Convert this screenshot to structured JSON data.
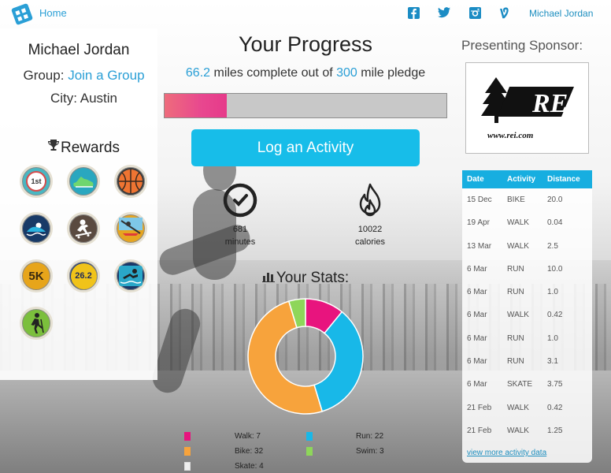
{
  "header": {
    "home_label": "Home",
    "user_name": "Michael Jordan",
    "social_icons": [
      "facebook-icon",
      "twitter-icon",
      "instagram-icon",
      "vine-icon"
    ]
  },
  "profile": {
    "name": "Michael Jordan",
    "group_prefix": "Group:",
    "group_link": "Join a Group",
    "city": "City: Austin",
    "rewards_title": "Rewards",
    "badges": [
      "first-place-badge",
      "running-shoe-badge",
      "basketball-badge",
      "swimming-badge",
      "skateboard-badge",
      "rowing-badge",
      "5k-badge",
      "26-2-marathon-badge",
      "swimmer-badge",
      "hiking-badge"
    ],
    "badge_text": {
      "first": "1st",
      "5k": "5K",
      "marathon": "26.2"
    }
  },
  "progress": {
    "title": "Your Progress",
    "miles_done": "66.2",
    "text_mid": "miles complete out of",
    "pledge": "300",
    "text_end": "mile pledge",
    "fraction": 0.221
  },
  "log_button": "Log an Activity",
  "stats": {
    "minutes_value": "681",
    "minutes_label": "minutes",
    "calories_value": "10022",
    "calories_label": "calories",
    "title": "Your Stats:"
  },
  "chart_data": {
    "type": "pie",
    "donut": true,
    "categories": [
      "Walk",
      "Run",
      "Bike",
      "Swim",
      "Skate"
    ],
    "values": [
      7,
      22,
      32,
      3,
      4
    ],
    "colors": [
      "#e8147e",
      "#18b8e8",
      "#f7a33c",
      "#8ed65a",
      "#eeeeee"
    ],
    "legend_labels": [
      "Walk: 7",
      "Run: 22",
      "Bike: 32",
      "Swim: 3",
      "Skate: 4"
    ]
  },
  "sponsor": {
    "title": "Presenting Sponsor:",
    "logo_text": "REI",
    "url_text": "www.rei.com"
  },
  "activity_table": {
    "headers": [
      "Date",
      "Activity",
      "Distance"
    ],
    "rows": [
      [
        "15 Dec",
        "BIKE",
        "20.0"
      ],
      [
        "19 Apr",
        "WALK",
        "0.04"
      ],
      [
        "13 Mar",
        "WALK",
        "2.5"
      ],
      [
        "6 Mar",
        "RUN",
        "10.0"
      ],
      [
        "6 Mar",
        "RUN",
        "1.0"
      ],
      [
        "6 Mar",
        "WALK",
        "0.42"
      ],
      [
        "6 Mar",
        "RUN",
        "1.0"
      ],
      [
        "6 Mar",
        "RUN",
        "3.1"
      ],
      [
        "6 Mar",
        "SKATE",
        "3.75"
      ],
      [
        "21 Feb",
        "WALK",
        "0.42"
      ],
      [
        "21 Feb",
        "WALK",
        "1.25"
      ]
    ],
    "more_link": "view more activity data"
  }
}
